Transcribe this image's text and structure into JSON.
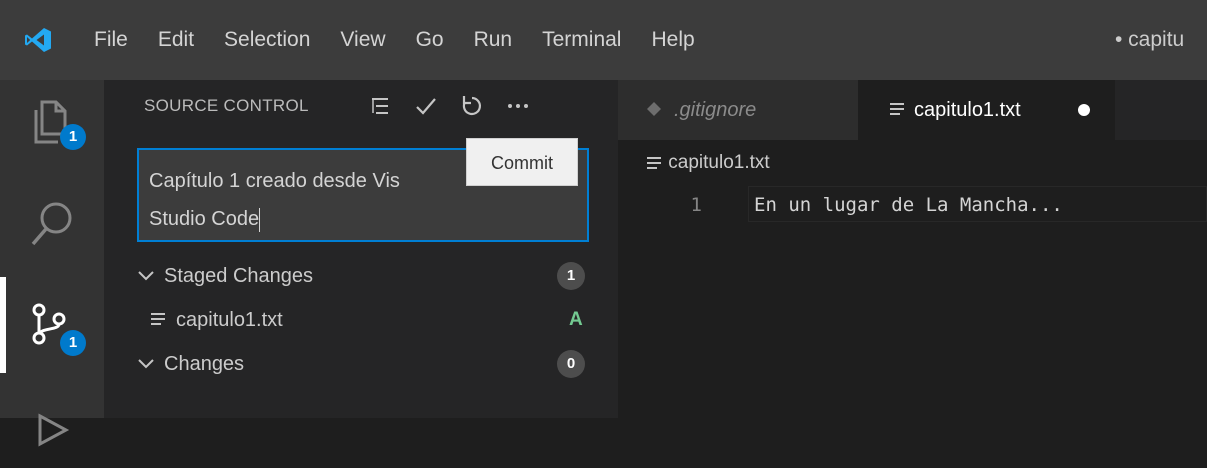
{
  "menu": {
    "items": [
      "File",
      "Edit",
      "Selection",
      "View",
      "Go",
      "Run",
      "Terminal",
      "Help"
    ],
    "window_title": "• capitu"
  },
  "activity_bar": {
    "explorer_badge": "1",
    "scm_badge": "1"
  },
  "scm": {
    "header": "SOURCE CONTROL",
    "commit_message_line1": "Capítulo 1 creado desde Vis",
    "commit_message_line2": "Studio Code",
    "tooltip": "Commit",
    "staged": {
      "label": "Staged Changes",
      "count": "1"
    },
    "staged_file": {
      "name": "capitulo1.txt",
      "status": "A"
    },
    "changes": {
      "label": "Changes",
      "count": "0"
    }
  },
  "editor": {
    "tabs": [
      {
        "label": ".gitignore",
        "active": false
      },
      {
        "label": "capitulo1.txt",
        "active": true,
        "dirty": true
      }
    ],
    "breadcrumb": "capitulo1.txt",
    "lines": [
      {
        "number": "1",
        "text": "En un lugar de La Mancha..."
      }
    ]
  },
  "colors": {
    "accent": "#007acc",
    "added": "#73c991",
    "titlebar": "#3c3c3c",
    "sidebar": "#252526",
    "editor": "#1e1e1e"
  },
  "icons": {
    "logo": "vscode-logo",
    "explorer": "files-icon",
    "search": "search-icon",
    "scm": "source-control-icon",
    "view_as_tree": "list-tree-icon",
    "commit": "check-icon",
    "refresh": "refresh-icon",
    "more": "ellipsis-icon",
    "file": "text-file-icon"
  }
}
